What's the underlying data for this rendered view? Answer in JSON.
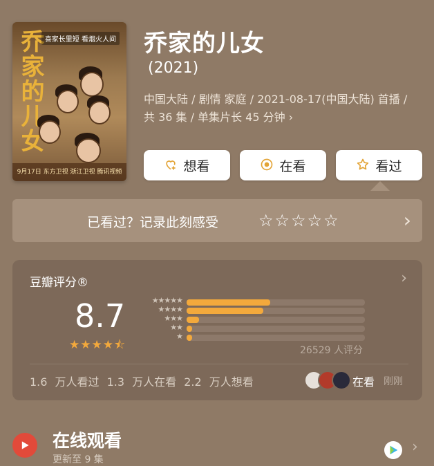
{
  "poster": {
    "title_art": "乔家的儿女",
    "tag": "喜家长里短 看烟火人间",
    "bottom": "9月17日 东方卫视 浙江卫视 腾讯视频"
  },
  "title": "乔家的儿女",
  "year": "(2021)",
  "meta": "中国大陆 / 剧情 家庭 / 2021-08-17(中国大陆) 首播 / 共 36 集 / 单集片长 45 分钟 ›",
  "buttons": {
    "want": "想看",
    "watching": "在看",
    "watched": "看过"
  },
  "record": {
    "text": "已看过？记录此刻感受",
    "stars": "☆☆☆☆☆",
    "chevron": "›"
  },
  "rating": {
    "title": "豆瓣评分®",
    "score": "8.7",
    "stars": "★★★★⯪",
    "distribution": [
      0.47,
      0.43,
      0.07,
      0.02,
      0.02
    ],
    "dist_labels": [
      "★★★★★",
      "★★★★",
      "★★★",
      "★★",
      "★"
    ],
    "count": "26529 人评分",
    "stats": "1.6 万人看过  1.3 万人在看  2.2 万人想看",
    "friend_status": "在看",
    "friend_time": "刚刚"
  },
  "online": {
    "title": "在线观看",
    "subtitle": "更新至 9 集"
  },
  "icons": {
    "want": "heart-plus-icon",
    "watching": "target-icon",
    "watched": "star-icon",
    "play": "play-icon",
    "video": "video-platform-icon"
  },
  "colors": {
    "background": "#8f7a66",
    "accent": "#f3a93c",
    "play": "#e24a3a"
  }
}
